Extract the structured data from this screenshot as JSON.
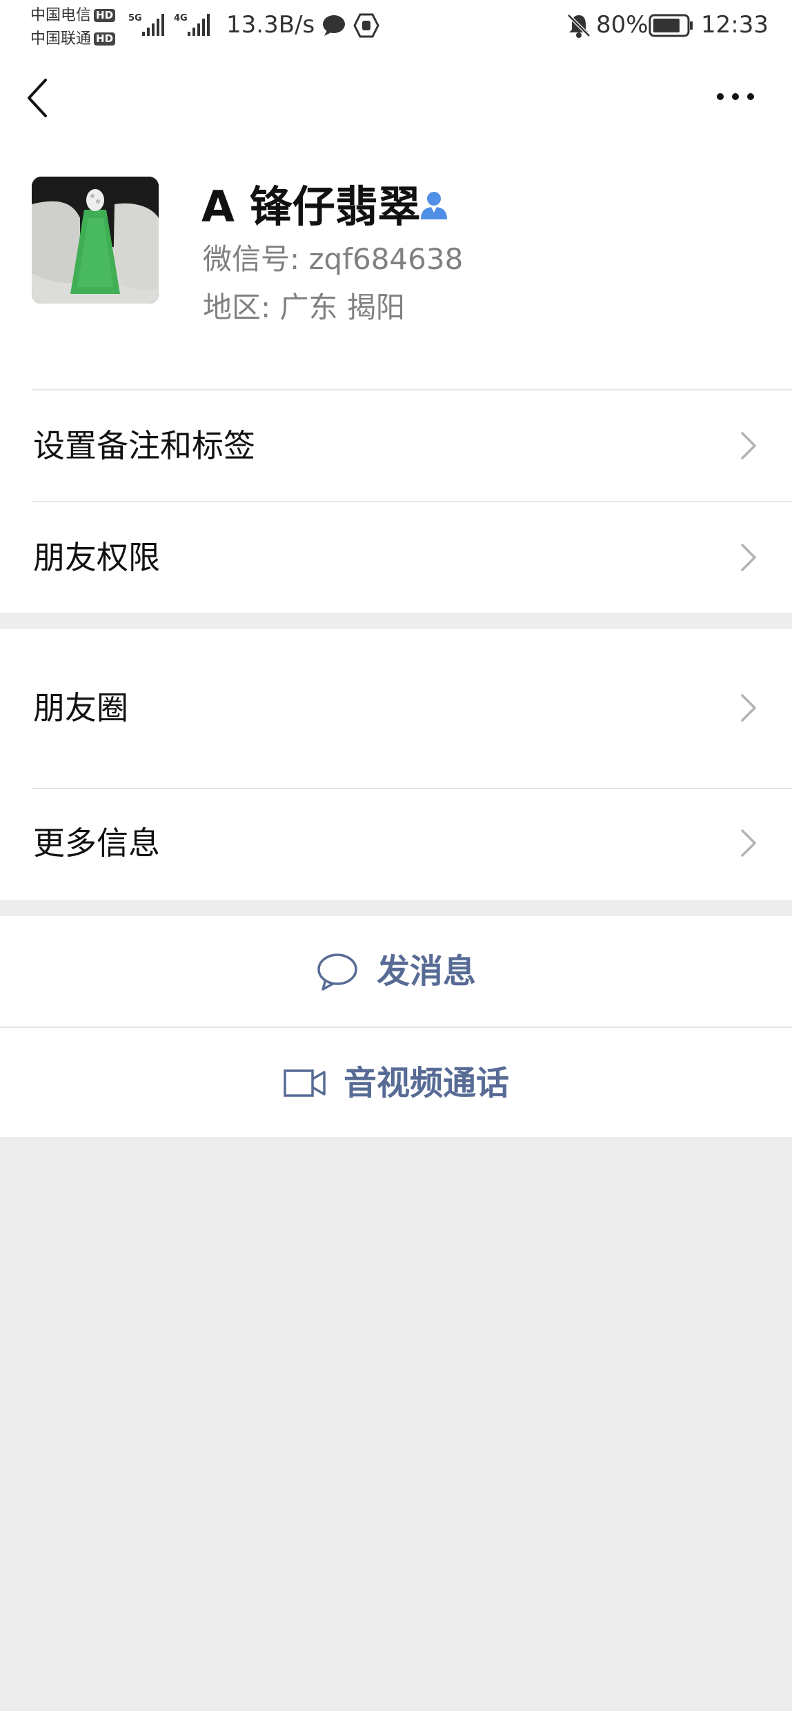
{
  "status_bar": {
    "carrier_1": "中国电信",
    "carrier_2": "中国联通",
    "hd_badge": "HD",
    "net_1": "5G",
    "net_2": "4G",
    "speed": "13.3B/s",
    "battery": "80%",
    "time": "12:33"
  },
  "header": {
    "back_icon": "chevron-left-icon",
    "more_icon": "more-dots-icon"
  },
  "profile": {
    "name": "A 锋仔翡翠",
    "wechat_id": "微信号: zqf684638",
    "region": "地区: 广东  揭阳",
    "avatar": "jade-pendant-photo"
  },
  "menu": {
    "remark_tags": "设置备注和标签",
    "permissions": "朋友权限",
    "moments": "朋友圈",
    "more_info": "更多信息"
  },
  "actions": {
    "message": "发消息",
    "call": "音视频通话"
  },
  "colors": {
    "background": "#ededed",
    "surface": "#ffffff",
    "link": "#576b95",
    "secondary_text": "#808080",
    "verified_blue": "#4f8fe6"
  }
}
